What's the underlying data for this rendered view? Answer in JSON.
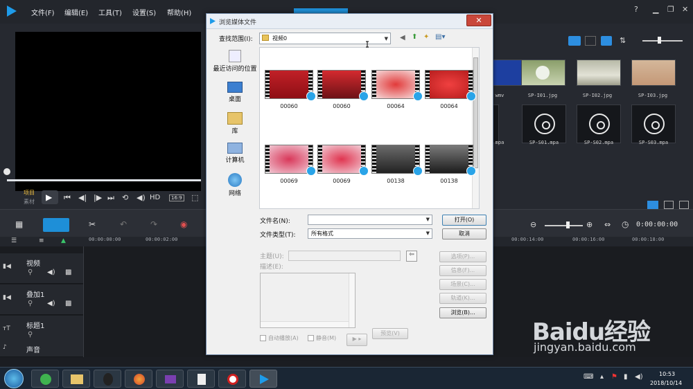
{
  "menu": {
    "items": [
      "文件(F)",
      "编辑(E)",
      "工具(T)",
      "设置(S)",
      "帮助(H)"
    ]
  },
  "preview": {
    "project_label": "项目",
    "clip_label": "素材",
    "hd_label": "HD",
    "ratio_label": "16:9"
  },
  "library": {
    "row1": [
      {
        "label": "wmv"
      },
      {
        "label": "SP-I01.jpg"
      },
      {
        "label": "SP-I02.jpg"
      },
      {
        "label": "SP-I03.jpg"
      }
    ],
    "row2": [
      {
        "label": "mpa"
      },
      {
        "label": "SP-S01.mpa"
      },
      {
        "label": "SP-S02.mpa"
      },
      {
        "label": "SP-S03.mpa"
      }
    ]
  },
  "timeline": {
    "timecode": "0:00:00:00",
    "ticks": [
      "00:00:00:00",
      "00:00:02:00",
      "00:00:14:00",
      "00:00:16:00",
      "00:00:18:00"
    ],
    "tracks": [
      {
        "name": "视频"
      },
      {
        "name": "叠加1"
      },
      {
        "name": "标题1"
      },
      {
        "name": "声音"
      }
    ]
  },
  "dialog": {
    "title": "浏览媒体文件",
    "look_in_label": "查找范围(I):",
    "look_in_value": "视频0",
    "places": [
      "最近访问的位置",
      "桌面",
      "库",
      "计算机",
      "网络"
    ],
    "files": [
      "00060",
      "00060",
      "00064",
      "00064",
      "00069",
      "00069",
      "00138",
      "00138"
    ],
    "filename_label": "文件名(N):",
    "filename_value": "",
    "filetype_label": "文件类型(T):",
    "filetype_value": "所有格式",
    "open_button": "打开(O)",
    "cancel_button": "取消",
    "subject_label": "主题(U):",
    "desc_label": "描述(E):",
    "options_button": "选项(P)...",
    "info_button": "信息(F)...",
    "scene_button": "场景(C)...",
    "track_button": "轨道(K)...",
    "browse_button": "浏览(B)...",
    "autoplay_label": "自动播放(A)",
    "mute_label": "静音(M)",
    "preview_button": "预览(V)"
  },
  "taskbar": {
    "time": "10:53",
    "date": "2018/10/14"
  },
  "watermark": {
    "brand": "Baidu经验",
    "url": "jingyan.baidu.com"
  }
}
